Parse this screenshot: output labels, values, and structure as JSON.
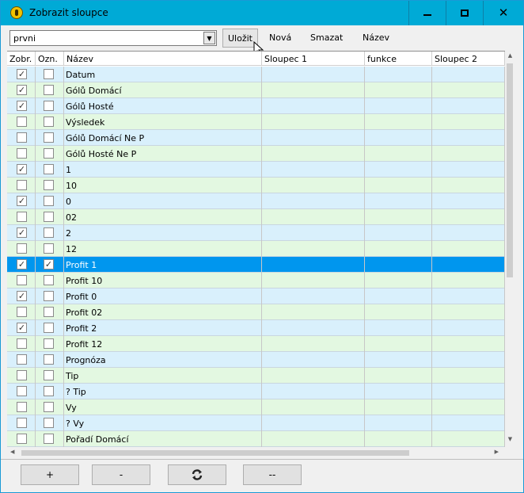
{
  "window": {
    "title": "Zobrazit sloupce"
  },
  "toolbar": {
    "preset_value": "prvni",
    "save_label": "Uložit",
    "new_label": "Nová",
    "delete_label": "Smazat",
    "name_label": "Název"
  },
  "table": {
    "headers": [
      "Zobr.",
      "Ozn.",
      "Název",
      "Sloupec 1",
      "funkce",
      "Sloupec 2"
    ],
    "rows": [
      {
        "show": true,
        "mark": false,
        "name": "Datum"
      },
      {
        "show": true,
        "mark": false,
        "name": "Gólů Domácí"
      },
      {
        "show": true,
        "mark": false,
        "name": "Gólů Hosté"
      },
      {
        "show": false,
        "mark": false,
        "name": "Výsledek"
      },
      {
        "show": false,
        "mark": false,
        "name": "Gólů Domácí Ne P"
      },
      {
        "show": false,
        "mark": false,
        "name": "Gólů Hosté Ne P"
      },
      {
        "show": true,
        "mark": false,
        "name": "1"
      },
      {
        "show": false,
        "mark": false,
        "name": "10"
      },
      {
        "show": true,
        "mark": false,
        "name": "0"
      },
      {
        "show": false,
        "mark": false,
        "name": "02"
      },
      {
        "show": true,
        "mark": false,
        "name": "2"
      },
      {
        "show": false,
        "mark": false,
        "name": "12"
      },
      {
        "show": true,
        "mark": true,
        "name": "Profit 1",
        "selected": true
      },
      {
        "show": false,
        "mark": false,
        "name": "Profit 10"
      },
      {
        "show": true,
        "mark": false,
        "name": "Profit 0"
      },
      {
        "show": false,
        "mark": false,
        "name": "Profit 02"
      },
      {
        "show": true,
        "mark": false,
        "name": "Profit 2"
      },
      {
        "show": false,
        "mark": false,
        "name": "Profit 12"
      },
      {
        "show": false,
        "mark": false,
        "name": "Prognóza"
      },
      {
        "show": false,
        "mark": false,
        "name": "Tip"
      },
      {
        "show": false,
        "mark": false,
        "name": "? Tip"
      },
      {
        "show": false,
        "mark": false,
        "name": "Vy"
      },
      {
        "show": false,
        "mark": false,
        "name": "? Vy"
      },
      {
        "show": false,
        "mark": false,
        "name": "Pořadí Domácí"
      }
    ]
  },
  "footer": {
    "add_label": "+",
    "remove_label": "-",
    "remove_all_label": "--",
    "refresh_icon": "refresh-icon"
  },
  "colors": {
    "titlebar": "#00aad6",
    "row_blue": "#d9f0fc",
    "row_green": "#e3f8e1",
    "row_selected": "#0096ee"
  }
}
